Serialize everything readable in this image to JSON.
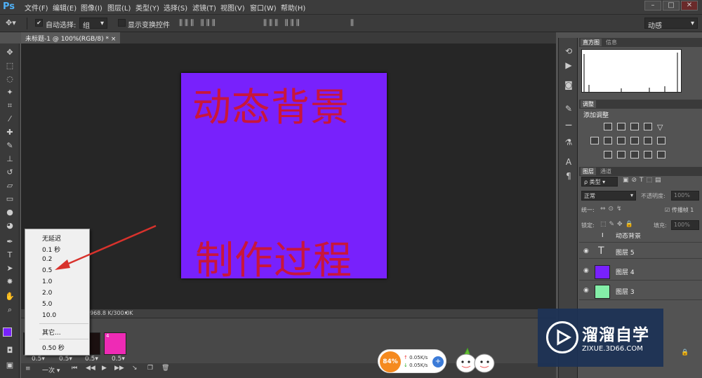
{
  "app": {
    "logo": "Ps"
  },
  "menu": [
    "文件(F)",
    "编辑(E)",
    "图像(I)",
    "图层(L)",
    "类型(Y)",
    "选择(S)",
    "滤镜(T)",
    "视图(V)",
    "窗口(W)",
    "帮助(H)"
  ],
  "window_controls": {
    "minimize": "–",
    "restore": "□",
    "close": "✕"
  },
  "options": {
    "auto_select_label": "自动选择:",
    "auto_select_value": "组",
    "show_transform_label": "显示变换控件",
    "workspace": "动感"
  },
  "document": {
    "tab_title": "未标题-1 @ 100%(RGB/8) *",
    "close": "×"
  },
  "canvas": {
    "text_top": "动态背景",
    "text_bottom": "制作过程",
    "bg_color": "#7821fc",
    "text_color": "#c8163c"
  },
  "status": {
    "doc_size": "968.8 K/300.0K"
  },
  "frame_delay_menu": {
    "items": [
      "无延迟",
      "0.1 秒",
      "0.2",
      "0.5",
      "1.0",
      "2.0",
      "5.0",
      "10.0"
    ],
    "other": "其它...",
    "current": "0.50 秒"
  },
  "timeline": {
    "frames": [
      {
        "num": "",
        "delay": "0.5▾",
        "color": "#111111"
      },
      {
        "num": "",
        "delay": "0.5▾",
        "color": "#222222"
      },
      {
        "num": "",
        "delay": "0.5▾",
        "color": "#1b1010"
      },
      {
        "num": "4",
        "delay": "0.5▾",
        "color": "#ee2bb5"
      }
    ],
    "loop": "一次"
  },
  "panels": {
    "histogram_tab": "直方图",
    "info_tab": "信息",
    "adjust_tab": "调整",
    "adjust_add": "添加调整",
    "layers_tab": "图层",
    "channels_tab": "通道",
    "filter_kind": "ρ 类型",
    "blend_mode": "正常",
    "opacity_label": "不透明度:",
    "opacity_value": "100%",
    "unify_label": "统一:",
    "propagate_label": "传播帧 1",
    "lock_label": "锁定:",
    "fill_label": "填充:",
    "fill_value": "100%",
    "layers": [
      {
        "name": "动态背景",
        "kind": "text"
      },
      {
        "name": "图层 5",
        "kind": "text"
      },
      {
        "name": "图层 4",
        "kind": "fill",
        "color": "#7821fc"
      },
      {
        "name": "图层 3",
        "kind": "fill",
        "color": "#84eea8"
      }
    ]
  },
  "watermark": {
    "title": "溜溜自学",
    "url": "ZIXUE.3D66.COM"
  },
  "net": {
    "percent": "84%",
    "up": "0.05K/s",
    "down": "0.05K/s"
  }
}
